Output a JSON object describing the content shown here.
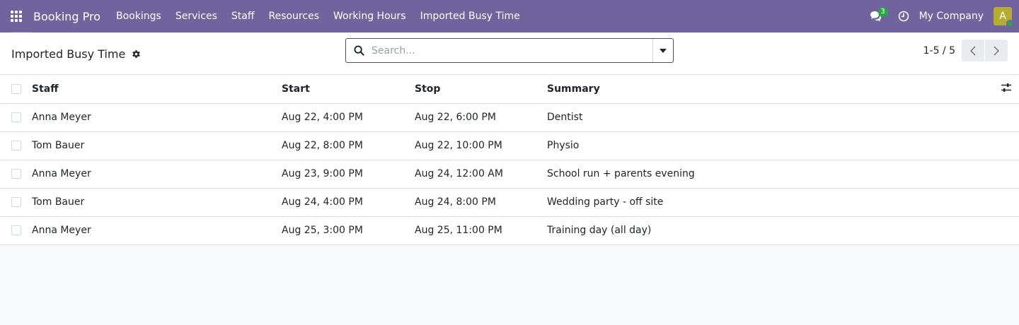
{
  "navbar": {
    "brand": "Booking Pro",
    "menu": [
      {
        "label": "Bookings"
      },
      {
        "label": "Services"
      },
      {
        "label": "Staff"
      },
      {
        "label": "Resources"
      },
      {
        "label": "Working Hours"
      },
      {
        "label": "Imported Busy Time"
      }
    ],
    "chat_count": "3",
    "company": "My Company",
    "avatar_initial": "A",
    "accent_color": "#71639e"
  },
  "control": {
    "title": "Imported Busy Time",
    "search_placeholder": "Search...",
    "pager": "1-5 / 5"
  },
  "table": {
    "columns": {
      "staff": "Staff",
      "start": "Start",
      "stop": "Stop",
      "summary": "Summary"
    },
    "rows": [
      {
        "staff": "Anna Meyer",
        "start": "Aug 22, 4:00 PM",
        "stop": "Aug 22, 6:00 PM",
        "summary": "Dentist"
      },
      {
        "staff": "Tom Bauer",
        "start": "Aug 22, 8:00 PM",
        "stop": "Aug 22, 10:00 PM",
        "summary": "Physio"
      },
      {
        "staff": "Anna Meyer",
        "start": "Aug 23, 9:00 PM",
        "stop": "Aug 24, 12:00 AM",
        "summary": "School run + parents evening"
      },
      {
        "staff": "Tom Bauer",
        "start": "Aug 24, 4:00 PM",
        "stop": "Aug 24, 8:00 PM",
        "summary": "Wedding party - off site"
      },
      {
        "staff": "Anna Meyer",
        "start": "Aug 25, 3:00 PM",
        "stop": "Aug 25, 11:00 PM",
        "summary": "Training day (all day)"
      }
    ]
  }
}
